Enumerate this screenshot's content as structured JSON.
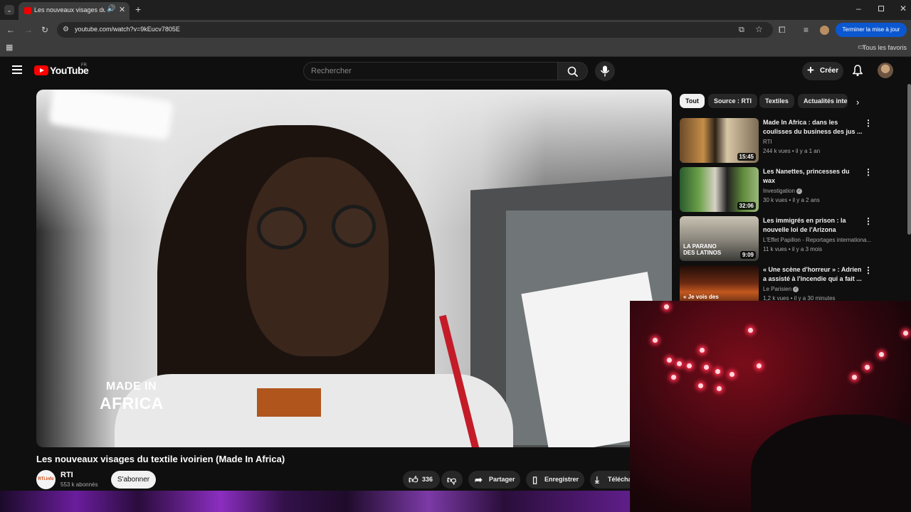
{
  "browser": {
    "tab_title": "Les nouveaux visages du textile ivoirien",
    "url": "youtube.com/watch?v=9kEucv7805E",
    "update_button": "Terminer la mise à jour",
    "bookmarks_label": "Tous les favoris"
  },
  "header": {
    "logo_text": "YouTube",
    "country_code": "FR",
    "search_placeholder": "Rechercher",
    "create_label": "Créer"
  },
  "video": {
    "overlay_line1": "MADE IN",
    "overlay_line2": "AFRICA",
    "title": "Les nouveaux visages du textile ivoirien (Made In Africa)",
    "channel_avatar_text": "RTI.info",
    "channel_name": "RTI",
    "subscribers": "553 k abonnés",
    "subscribe_label": "S'abonner",
    "likes": "336",
    "share_label": "Partager",
    "save_label": "Enregistrer",
    "download_label": "Téléchar"
  },
  "chips": [
    "Tout",
    "Source : RTI",
    "Textiles",
    "Actualités inte"
  ],
  "recommendations": [
    {
      "title": "Made In Africa : dans les coulisses du business des jus ...",
      "channel": "RTI",
      "verified": false,
      "meta": "244 k vues • il y a 1 an",
      "duration": "15:45",
      "thumb_text": ""
    },
    {
      "title": "Les Nanettes, princesses du wax",
      "channel": "Investigation",
      "verified": true,
      "meta": "30 k vues • il y a 2 ans",
      "duration": "32:06",
      "thumb_text": ""
    },
    {
      "title": "Les immigrés en prison : la nouvelle loi de l'Arizona",
      "channel": "L'Effet Papillon - Reportages internationa...",
      "verified": false,
      "meta": "11 k vues • il y a 3 mois",
      "duration": "9:09",
      "thumb_text": "LA PARANO DES LATINOS"
    },
    {
      "title": "« Une scène d'horreur » : Adrien a assisté à l'incendie qui a fait ...",
      "channel": "Le Parisien",
      "verified": true,
      "meta": "1,2 k vues • il y a 30 minutes",
      "duration": "",
      "thumb_text": "« Je vois des"
    }
  ],
  "colors": {
    "accent_red": "#ff0000",
    "update_blue": "#0b57d0",
    "bg": "#0f0f0f"
  }
}
